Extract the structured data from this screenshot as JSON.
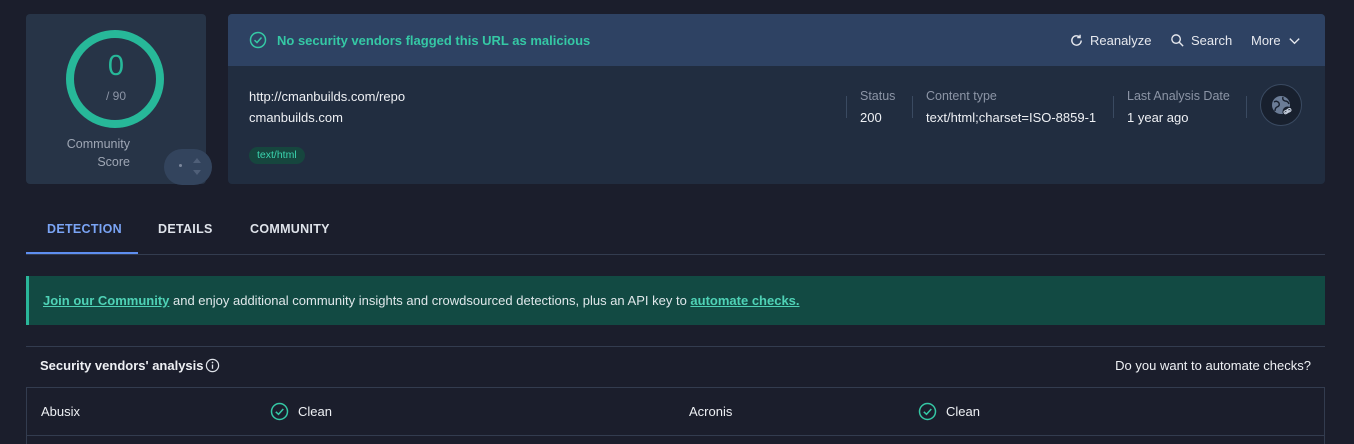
{
  "score": {
    "value": "0",
    "total": "/ 90",
    "label": "Community Score"
  },
  "summary": {
    "status_message": "No security vendors flagged this URL as malicious",
    "actions": {
      "reanalyze": "Reanalyze",
      "search": "Search",
      "more": "More"
    },
    "url": "http://cmanbuilds.com/repo",
    "domain": "cmanbuilds.com",
    "tag": "text/html",
    "meta": {
      "status_label": "Status",
      "status_value": "200",
      "content_type_label": "Content type",
      "content_type_value": "text/html;charset=ISO-8859-1",
      "last_analysis_label": "Last Analysis Date",
      "last_analysis_value": "1 year ago"
    }
  },
  "tabs": [
    "DETECTION",
    "DETAILS",
    "COMMUNITY"
  ],
  "banner": {
    "link1": "Join our Community",
    "text": " and enjoy additional community insights and crowdsourced detections, plus an API key to ",
    "link2": "automate checks."
  },
  "vendors": {
    "title": "Security vendors' analysis",
    "automate_question": "Do you want to automate checks?",
    "rows": [
      {
        "name": "Abusix",
        "result": "Clean"
      },
      {
        "name": "Acronis",
        "result": "Clean"
      }
    ]
  },
  "colors": {
    "accent_green": "#27b899",
    "accent_blue": "#5e8ef0",
    "background": "#1b1e2c"
  }
}
